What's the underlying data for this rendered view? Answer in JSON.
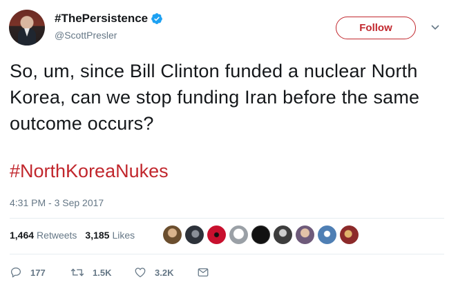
{
  "user": {
    "display_name": "#ThePersistence",
    "handle": "@ScottPresler",
    "verified": true
  },
  "follow_button": {
    "label": "Follow"
  },
  "tweet": {
    "text": "So, um, since Bill Clinton funded a nuclear North Korea, can we stop funding Iran before the same outcome occurs?",
    "hashtag": "#NorthKoreaNukes",
    "timestamp": "4:31 PM - 3 Sep 2017"
  },
  "stats": {
    "retweets_count": "1,464",
    "retweets_label": "Retweets",
    "likes_count": "3,185",
    "likes_label": "Likes"
  },
  "likers": [
    {
      "icon": "liker-avatar-1",
      "color": "#9a7a52"
    },
    {
      "icon": "liker-avatar-2",
      "color": "#3a3f4a"
    },
    {
      "icon": "liker-avatar-3",
      "color": "#c8102e"
    },
    {
      "icon": "liker-avatar-4",
      "color": "#d9d9d9"
    },
    {
      "icon": "liker-avatar-5",
      "color": "#111111"
    },
    {
      "icon": "liker-avatar-6",
      "color": "#4d4d4d"
    },
    {
      "icon": "liker-avatar-7",
      "color": "#7b6a86"
    },
    {
      "icon": "liker-avatar-8",
      "color": "#5b86b5"
    },
    {
      "icon": "liker-avatar-9",
      "color": "#8c2a2a"
    }
  ],
  "actions": {
    "replies": "177",
    "retweets": "1.5K",
    "likes": "3.2K"
  },
  "colors": {
    "accent": "#c1272d",
    "muted": "#657786",
    "verified": "#1da1f2"
  }
}
